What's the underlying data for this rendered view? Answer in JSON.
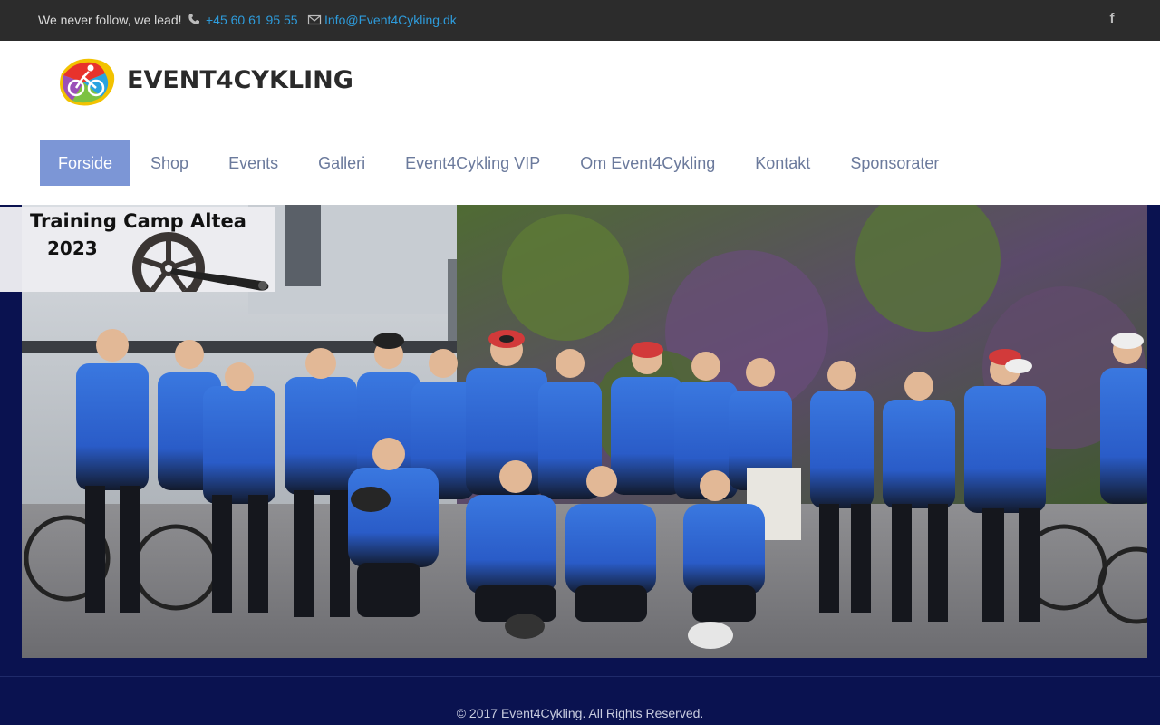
{
  "topbar": {
    "slogan": "We never follow, we lead!",
    "phone": "+45 60 61 95 55",
    "email": "Info@Event4Cykling.dk",
    "social_icon": "f"
  },
  "header": {
    "logo_text": "EVENT4CYKLING",
    "nav": [
      {
        "label": "Forside",
        "active": true
      },
      {
        "label": "Shop"
      },
      {
        "label": "Events"
      },
      {
        "label": "Galleri"
      },
      {
        "label": "Event4Cykling VIP"
      },
      {
        "label": "Om Event4Cykling"
      },
      {
        "label": "Kontakt"
      },
      {
        "label": "Sponsorater"
      }
    ]
  },
  "hero": {
    "promo_title": "Training Camp Altea",
    "promo_year": "2023"
  },
  "footer": {
    "copyright": "© 2017 Event4Cykling. All Rights Reserved."
  },
  "colors": {
    "topbar_bg": "#2c2c2c",
    "link": "#2e9cdc",
    "nav_active_bg": "#7c96d6",
    "nav_text": "#6b7a9c",
    "page_bg": "#0a1250",
    "jersey_blue": "#2a63d4"
  },
  "icons": [
    "phone-icon",
    "mail-icon",
    "facebook-icon",
    "chainring-icon",
    "logo-icon"
  ]
}
